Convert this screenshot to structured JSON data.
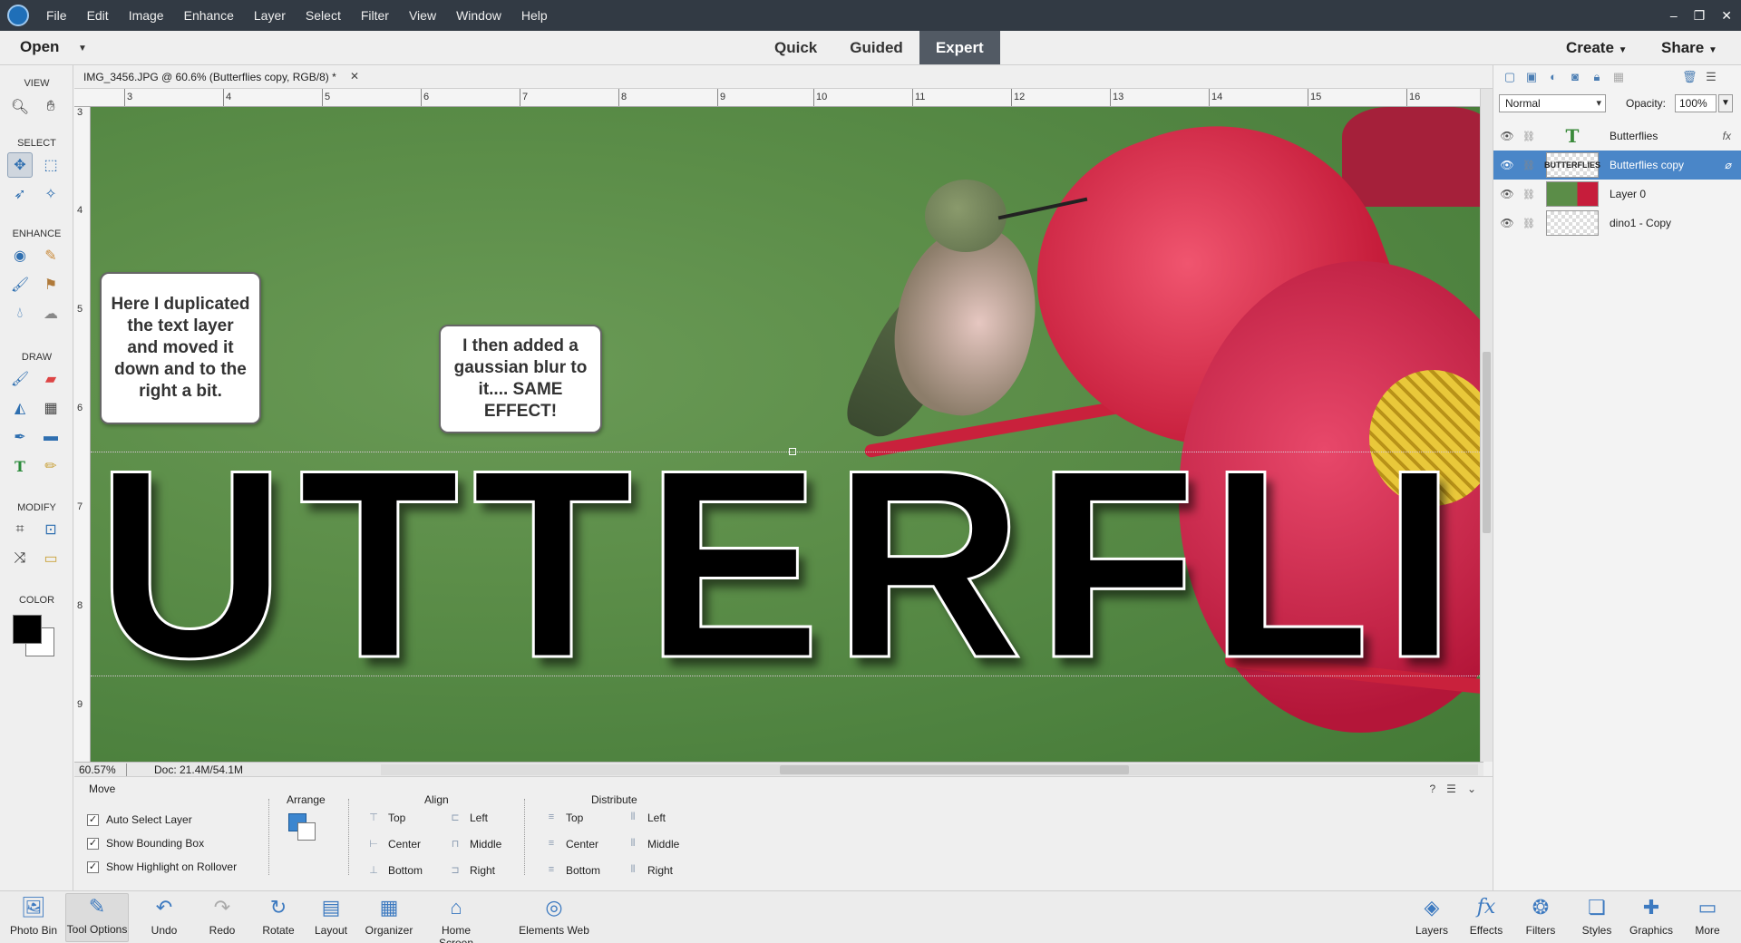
{
  "menubar": {
    "items": [
      "File",
      "Edit",
      "Image",
      "Enhance",
      "Layer",
      "Select",
      "Filter",
      "View",
      "Window",
      "Help"
    ],
    "win_min": "–",
    "win_restore": "❐",
    "win_close": "✕"
  },
  "modebar": {
    "open_label": "Open",
    "tabs": [
      "Quick",
      "Guided",
      "Expert"
    ],
    "active_tab": "Expert",
    "create_label": "Create",
    "share_label": "Share"
  },
  "toolbox": {
    "sections": [
      "VIEW",
      "SELECT",
      "ENHANCE",
      "DRAW",
      "MODIFY",
      "COLOR"
    ],
    "foreground_color": "#000000",
    "background_color": "#ffffff"
  },
  "document": {
    "tab_title": "IMG_3456.JPG @ 60.6% (Butterflies copy, RGB/8) *",
    "ruler_h": [
      "3",
      "4",
      "5",
      "6",
      "7",
      "8",
      "9",
      "10",
      "11",
      "12",
      "13",
      "14",
      "15",
      "16"
    ],
    "ruler_v": [
      "3",
      "4",
      "5",
      "6",
      "7",
      "8",
      "9"
    ],
    "callout_1": "Here I duplicated the text layer and moved it down and to the right a bit.",
    "callout_2": "I then added a gaussian blur to it.... SAME EFFECT!",
    "canvas_text": "UTTERFLIE",
    "zoom": "60.57%",
    "doc_size": "Doc: 21.4M/54.1M"
  },
  "tool_options": {
    "tool_name": "Move",
    "checkboxes": [
      "Auto Select Layer",
      "Show Bounding Box",
      "Show Highlight on Rollover"
    ],
    "arrange_label": "Arrange",
    "align_label": "Align",
    "align_items": [
      "Top",
      "Center",
      "Bottom",
      "Left",
      "Middle",
      "Right"
    ],
    "distribute_label": "Distribute",
    "distribute_items": [
      "Top",
      "Center",
      "Bottom",
      "Left",
      "Middle",
      "Right"
    ]
  },
  "layers_panel": {
    "blend_mode": "Normal",
    "opacity_label": "Opacity:",
    "opacity_value": "100%",
    "layers": [
      {
        "name": "Butterflies",
        "thumb": "T",
        "fx": "fx"
      },
      {
        "name": "Butterflies copy",
        "thumb": "BUTTERFLIES"
      },
      {
        "name": "Layer 0",
        "thumb": ""
      },
      {
        "name": "dino1 - Copy",
        "thumb": ""
      }
    ],
    "selected_layer": "Butterflies copy"
  },
  "taskbar": {
    "left": [
      "Photo Bin",
      "Tool Options",
      "Undo",
      "Redo",
      "Rotate",
      "Layout",
      "Organizer",
      "Home Screen",
      "Elements Web"
    ],
    "right": [
      "Layers",
      "Effects",
      "Filters",
      "Styles",
      "Graphics",
      "More"
    ]
  }
}
